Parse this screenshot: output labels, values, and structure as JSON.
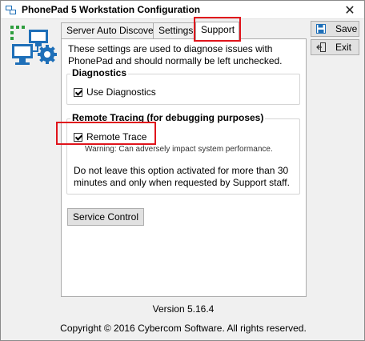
{
  "window": {
    "title": "PhonePad 5 Workstation Configuration",
    "close_glyph": "✕"
  },
  "tabs": [
    {
      "label": "Server Auto Discovery",
      "active": false
    },
    {
      "label": "Settings",
      "active": false
    },
    {
      "label": "Support",
      "active": true
    }
  ],
  "support": {
    "intro": "These settings are used to diagnose issues with PhonePad and should normally be left unchecked.",
    "diagnostics": {
      "title": "Diagnostics",
      "checkbox_label": "Use Diagnostics",
      "checked": true
    },
    "remote_tracing": {
      "title": "Remote Tracing (for debugging purposes)",
      "checkbox_label": "Remote Trace",
      "checked": true,
      "warning": "Warning: Can adversely impact system performance.",
      "note": "Do not leave this option activated for more than 30 minutes and only when requested by Support staff."
    },
    "service_control_label": "Service Control"
  },
  "side_buttons": {
    "save_label": "Save",
    "exit_label": "Exit"
  },
  "footer": {
    "version": "Version 5.16.4",
    "copyright": "Copyright © 2016 Cybercom Software. All rights reserved."
  },
  "colors": {
    "accent": "#1e6fb8",
    "highlight_border": "#e0141c",
    "logo_green": "#2e9e3e",
    "logo_blue": "#1e6fb8"
  },
  "icons": {
    "app": "phonepad-app-icon",
    "logo": "computer-network-gear-icon",
    "save": "floppy-disk-icon",
    "exit": "exit-door-icon",
    "close": "close-icon"
  }
}
